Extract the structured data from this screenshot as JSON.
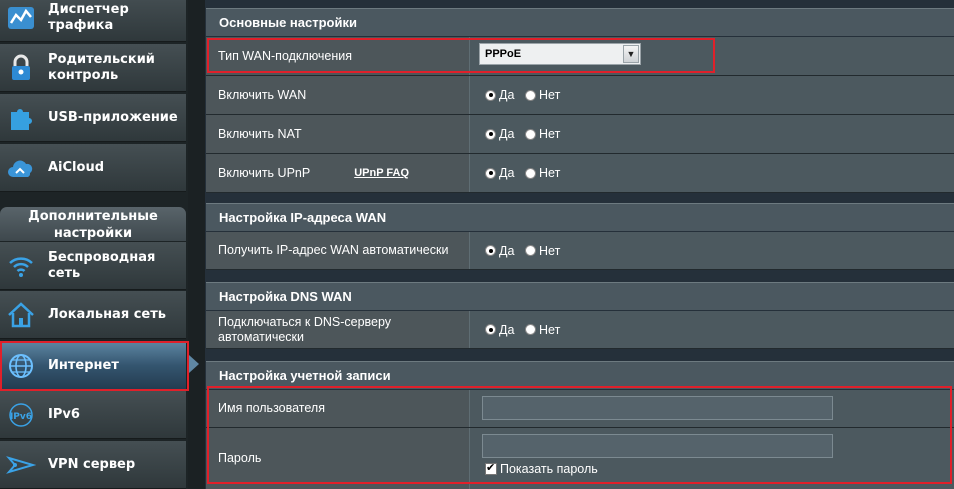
{
  "sidebar": {
    "items": [
      {
        "label": "Диспетчер трафика",
        "icon": "traffic-monitor-icon"
      },
      {
        "label": "Родительский контроль",
        "icon": "lock-icon"
      },
      {
        "label": "USB-приложение",
        "icon": "puzzle-icon"
      },
      {
        "label": "AiCloud",
        "icon": "cloud-icon"
      },
      {
        "label": "Беспроводная сеть",
        "icon": "wifi-icon"
      },
      {
        "label": "Локальная сеть",
        "icon": "home-icon"
      },
      {
        "label": "Интернет",
        "icon": "globe-icon",
        "active": true
      },
      {
        "label": "IPv6",
        "icon": "ipv6-icon"
      },
      {
        "label": "VPN сервер",
        "icon": "vpn-icon"
      }
    ],
    "section_header": "Дополнительные настройки"
  },
  "basic": {
    "title": "Основные настройки",
    "wan_type_label": "Тип WAN-подключения",
    "wan_type_value": "PPPoE",
    "enable_wan_label": "Включить WAN",
    "enable_nat_label": "Включить NAT",
    "enable_upnp_label": "Включить UPnP",
    "upnp_faq": "UPnP  FAQ"
  },
  "radio": {
    "yes": "Да",
    "no": "Нет"
  },
  "wan_ip": {
    "title": "Настройка IP-адреса WAN",
    "auto_label": "Получить IP-адрес WAN автоматически"
  },
  "wan_dns": {
    "title": "Настройка DNS WAN",
    "auto_label": "Подключаться к DNS-серверу автоматически"
  },
  "account": {
    "title": "Настройка учетной записи",
    "username_label": "Имя пользователя",
    "username_value": "",
    "password_label": "Пароль",
    "password_value": "",
    "show_password_label": "Показать пароль",
    "show_password_checked": true
  },
  "colors": {
    "highlight": "#e0202a",
    "active_menu": "#5f87a4"
  }
}
